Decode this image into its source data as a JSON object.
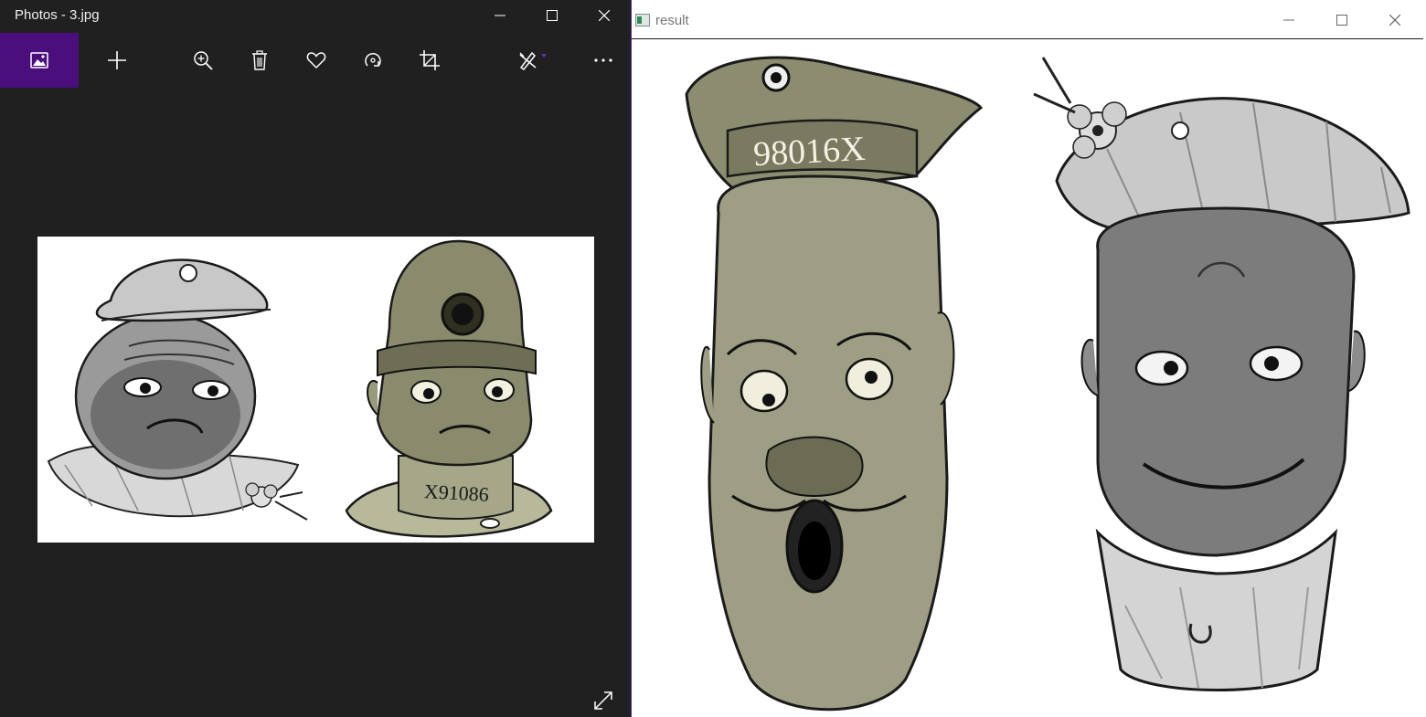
{
  "photos_window": {
    "title": "Photos - 3.jpg",
    "toolbar": [
      {
        "name": "photo-icon",
        "label": "See all photos"
      },
      {
        "name": "plus-icon",
        "label": "Add to"
      },
      {
        "name": "zoom-in-icon",
        "label": "Zoom"
      },
      {
        "name": "trash-icon",
        "label": "Delete"
      },
      {
        "name": "heart-icon",
        "label": "Add to favorites"
      },
      {
        "name": "rotate-icon",
        "label": "Rotate"
      },
      {
        "name": "crop-icon",
        "label": "Crop"
      },
      {
        "name": "edit-create-icon",
        "label": "Edit & Create"
      },
      {
        "name": "more-icon",
        "label": "See more"
      }
    ],
    "image": {
      "left_head_text": "",
      "right_head_collar_text": "X91086"
    },
    "accent_color": "#4b0f7d"
  },
  "result_window": {
    "title": "result",
    "image": {
      "left_head_cap_text": "98016X"
    }
  }
}
